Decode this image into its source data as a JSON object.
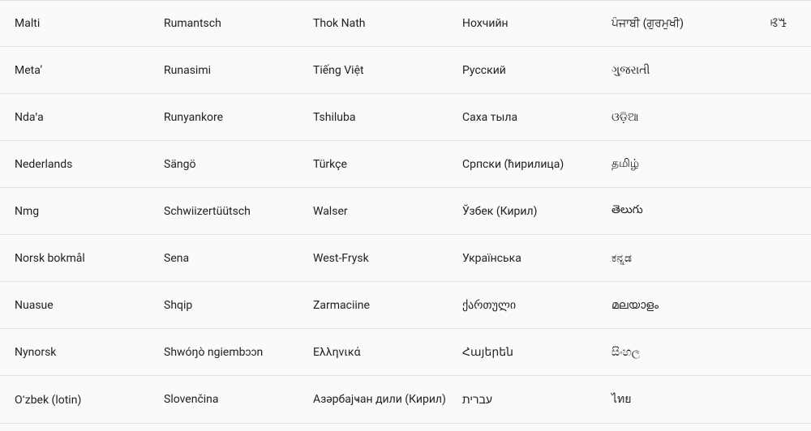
{
  "languages": {
    "rows": [
      {
        "c0": "Malti",
        "c1": "Rumantsch",
        "c2": "Thok Nath",
        "c3": "Нохчийн",
        "c4": "ਪੰਜਾਬੀ (ਗੁਰਮੁਖੀ)",
        "c5": "ꕙꔤ"
      },
      {
        "c0": "Metaʼ",
        "c1": "Runasimi",
        "c2": "Tiếng Việt",
        "c3": "Русский",
        "c4": "ગુજરાતી",
        "c5": ""
      },
      {
        "c0": "Ndaꞌa",
        "c1": "Runyankore",
        "c2": "Tshiluba",
        "c3": "Саха тыла",
        "c4": "ଓଡ଼ିଆ",
        "c5": ""
      },
      {
        "c0": "Nederlands",
        "c1": "Sängö",
        "c2": "Türkçe",
        "c3": "Српски (ћирилица)",
        "c4": "தமிழ்",
        "c5": ""
      },
      {
        "c0": "Nmg",
        "c1": "Schwiizertüütsch",
        "c2": "Walser",
        "c3": "Ўзбек (Кирил)",
        "c4": "తెలుగు",
        "c5": ""
      },
      {
        "c0": "Norsk bokmål",
        "c1": "Sena",
        "c2": "West-Frysk",
        "c3": "Українська",
        "c4": "ಕನ್ನಡ",
        "c5": ""
      },
      {
        "c0": "Nuasue",
        "c1": "Shqip",
        "c2": "Zarmaciine",
        "c3": "ქართული",
        "c4": "മലയാളം",
        "c5": ""
      },
      {
        "c0": "Nynorsk",
        "c1": "Shwóŋò ngiembɔɔn",
        "c2": "Ελληνικά",
        "c3": "Հայերեն",
        "c4": "සිංහල",
        "c5": ""
      },
      {
        "c0": "Oʻzbek (lotin)",
        "c1": "Slovenčina",
        "c2": "Азәрбајҹан дили (Кирил)",
        "c3": "עברית",
        "c4": "ไทย",
        "c5": ""
      }
    ]
  }
}
